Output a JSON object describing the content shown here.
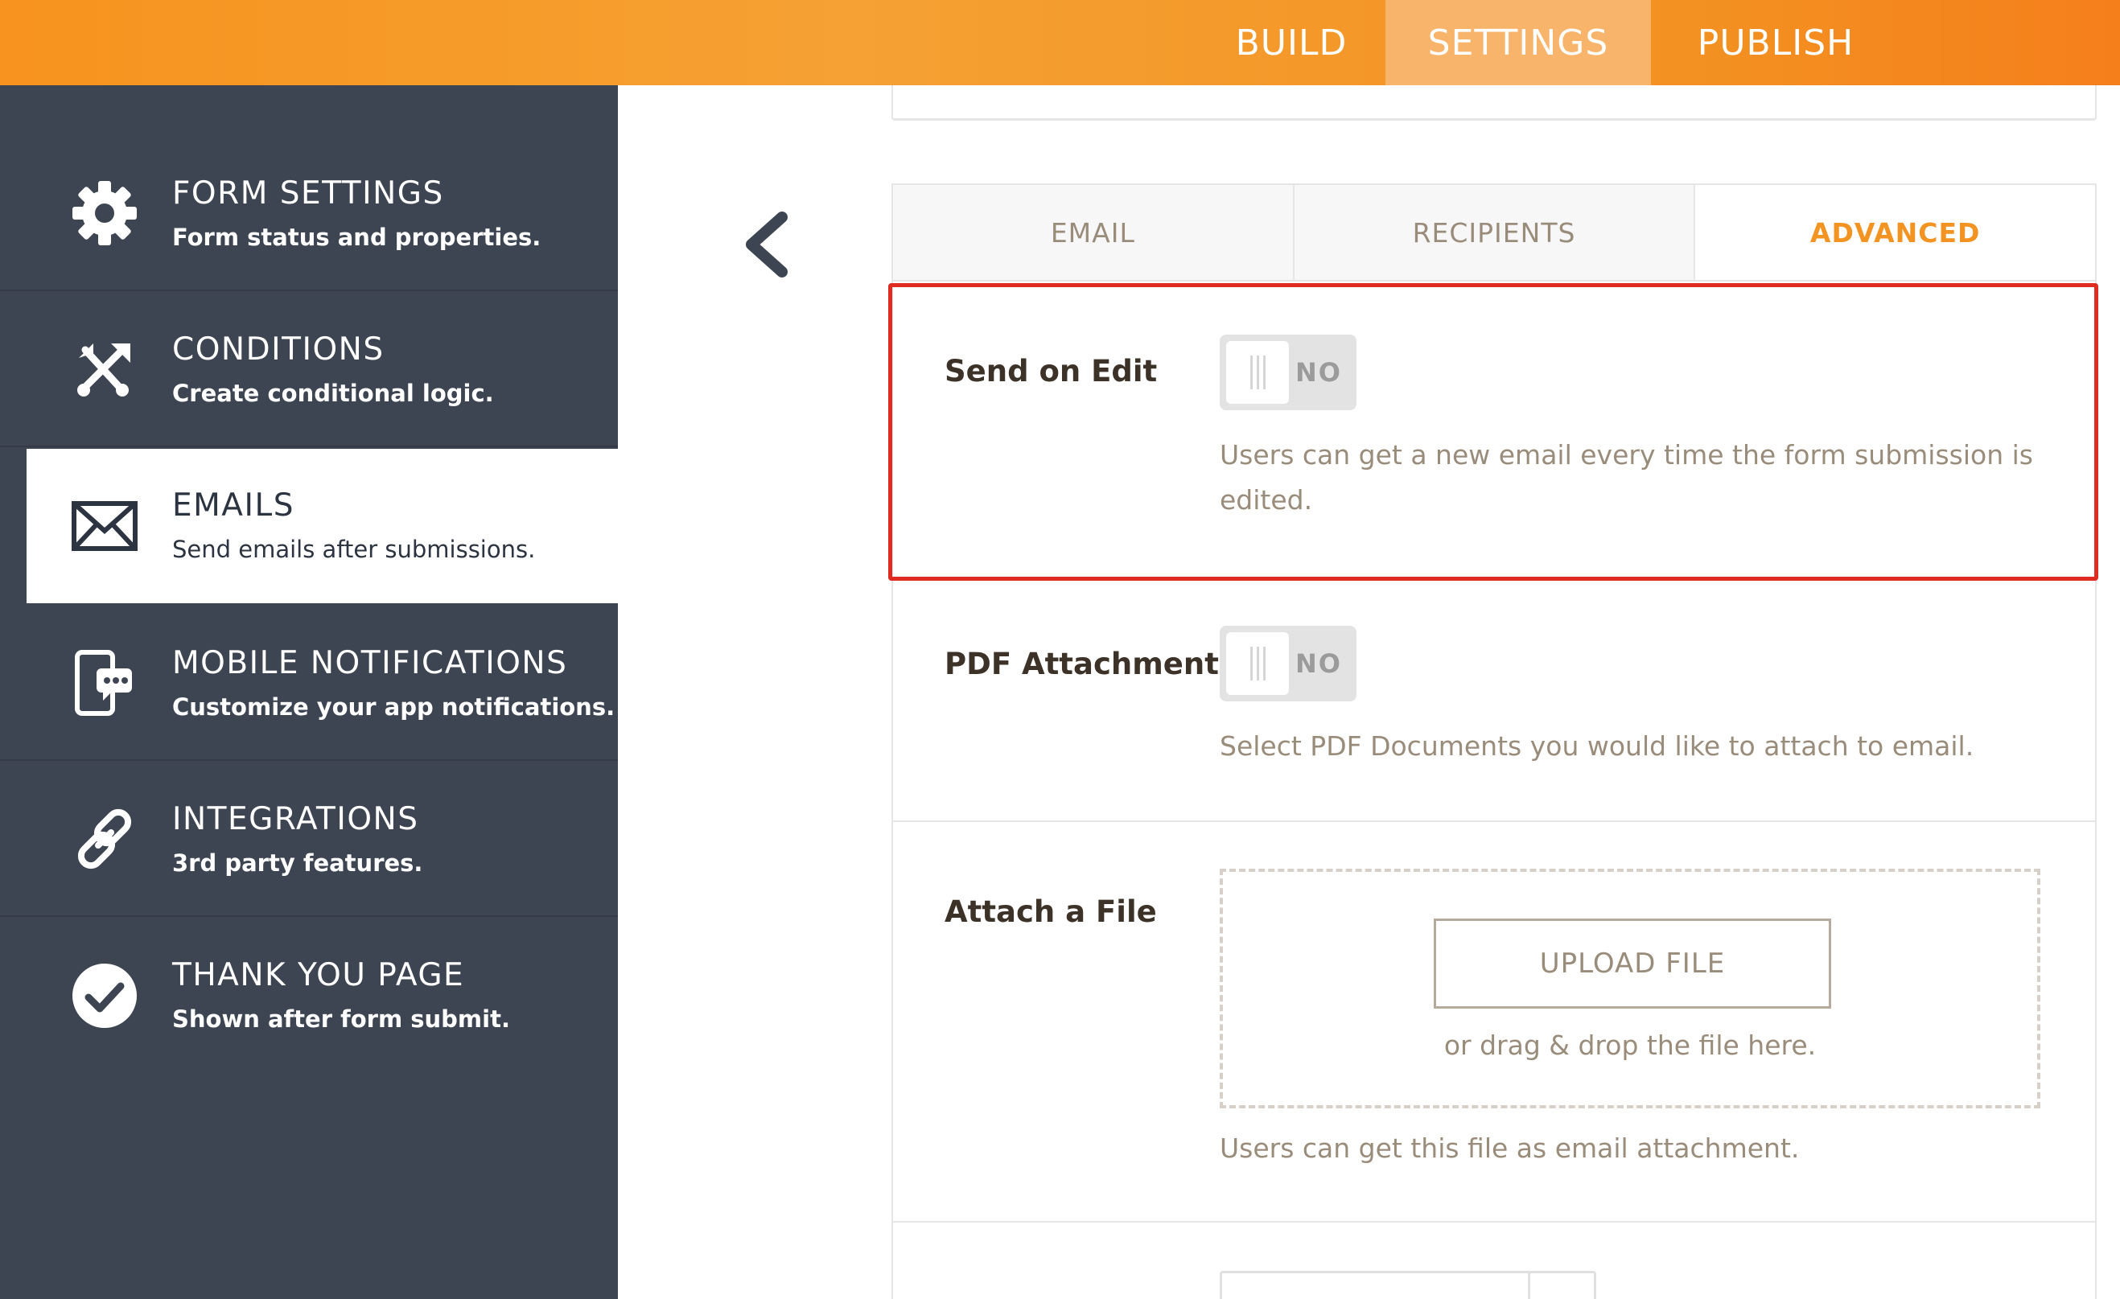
{
  "topbar": {
    "tabs": [
      {
        "label": "BUILD",
        "active": false
      },
      {
        "label": "SETTINGS",
        "active": true
      },
      {
        "label": "PUBLISH",
        "active": false
      }
    ]
  },
  "sidebar": {
    "items": [
      {
        "title": "FORM SETTINGS",
        "desc": "Form status and properties.",
        "icon": "gear-icon",
        "active": false
      },
      {
        "title": "CONDITIONS",
        "desc": "Create conditional logic.",
        "icon": "conditions-icon",
        "active": false
      },
      {
        "title": "EMAILS",
        "desc": "Send emails after submissions.",
        "icon": "envelope-icon",
        "active": true
      },
      {
        "title": "MOBILE NOTIFICATIONS",
        "desc": "Customize your app notifications.",
        "icon": "mobile-notification-icon",
        "active": false
      },
      {
        "title": "INTEGRATIONS",
        "desc": "3rd party features.",
        "icon": "link-icon",
        "active": false
      },
      {
        "title": "THANK YOU PAGE",
        "desc": "Shown after form submit.",
        "icon": "check-circle-icon",
        "active": false
      }
    ]
  },
  "subtabs": [
    {
      "label": "EMAIL",
      "active": false
    },
    {
      "label": "RECIPIENTS",
      "active": false
    },
    {
      "label": "ADVANCED",
      "active": true
    }
  ],
  "settings": {
    "send_on_edit": {
      "label": "Send on Edit",
      "toggle": "NO",
      "help": "Users can get a new email every time the form submission is edited."
    },
    "pdf_attachment": {
      "label": "PDF Attachment",
      "toggle": "NO",
      "help": "Select PDF Documents you would like to attach to email."
    },
    "attach_file": {
      "label": "Attach a File",
      "button": "UPLOAD FILE",
      "hint": "or drag & drop the file here.",
      "help": "Users can get this file as email attachment."
    }
  },
  "colors": {
    "accent": "#f29322",
    "sidebar_bg": "#3e4552",
    "highlight": "#e02b20",
    "muted_text": "#9a8c7a"
  }
}
